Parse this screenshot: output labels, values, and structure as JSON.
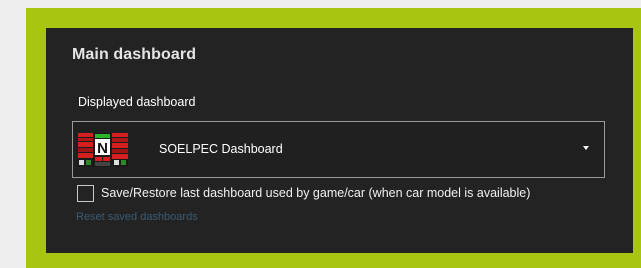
{
  "section": {
    "title": "Main dashboard"
  },
  "displayed_dashboard": {
    "label": "Displayed dashboard",
    "selected": "SOELPEC Dashboard",
    "thumbnail_badge": "N",
    "thumbnail_icon": "dashboard-thumbnail-icon"
  },
  "options": {
    "save_restore_label": "Save/Restore last dashboard used by game/car (when car model is available)",
    "save_restore_checked": false,
    "reset_link": "Reset saved dashboards"
  },
  "colors": {
    "accent_frame": "#a8c512",
    "panel_bg": "#232323",
    "link": "#3b5a72"
  }
}
